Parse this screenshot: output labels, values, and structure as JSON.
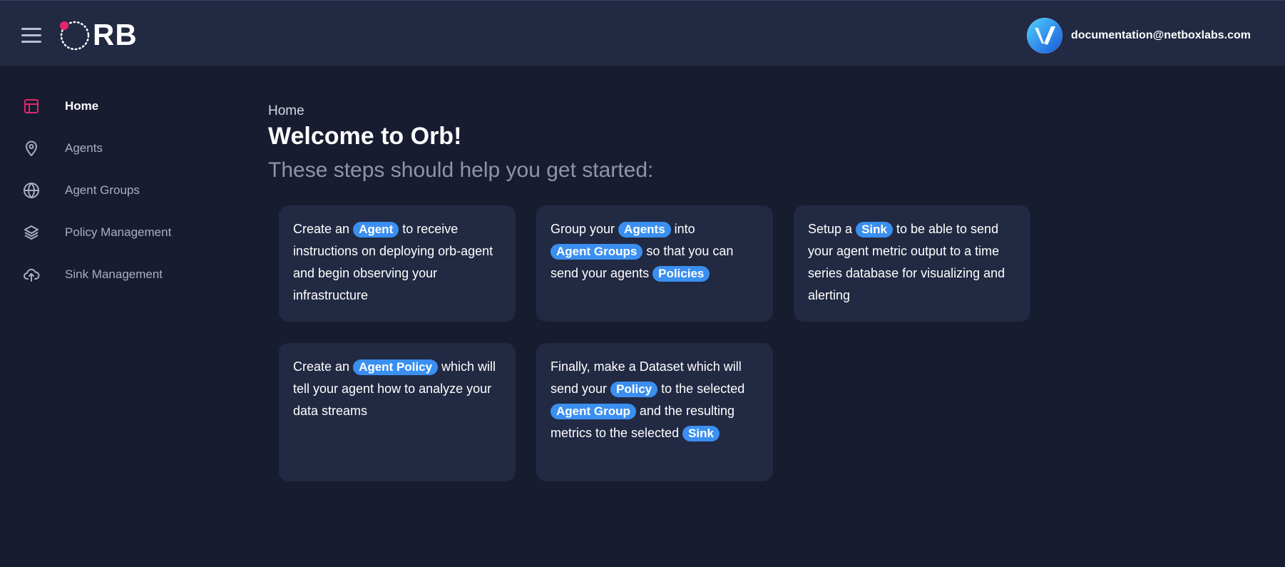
{
  "header": {
    "logo_text": "RB",
    "user_email": "documentation@netboxlabs.com"
  },
  "colors": {
    "accent": "#e4256a",
    "chip": "#3a8ff0",
    "background": "#171c30",
    "panel": "#222942"
  },
  "sidebar": {
    "items": [
      {
        "label": "Home",
        "icon": "layout-icon",
        "active": true
      },
      {
        "label": "Agents",
        "icon": "map-pin-icon",
        "active": false
      },
      {
        "label": "Agent Groups",
        "icon": "globe-icon",
        "active": false
      },
      {
        "label": "Policy Management",
        "icon": "layers-icon",
        "active": false
      },
      {
        "label": "Sink Management",
        "icon": "cloud-upload-icon",
        "active": false
      }
    ]
  },
  "main": {
    "breadcrumb": "Home",
    "title": "Welcome to Orb!",
    "subtitle": "These steps should help you get started:",
    "cards": [
      {
        "t1": "Create an ",
        "c1": "Agent",
        "t2": " to receive instructions on deploying orb-agent and begin observing your infrastructure"
      },
      {
        "t1": "Group your ",
        "c1": "Agents",
        "t2": " into ",
        "c2": "Agent Groups",
        "t3": " so that you can send your agents ",
        "c3": "Policies"
      },
      {
        "t1": "Setup a ",
        "c1": "Sink",
        "t2": " to be able to send your agent metric output to a time series database for visualizing and alerting"
      },
      {
        "t1": "Create an ",
        "c1": "Agent Policy",
        "t2": " which will tell your agent how to analyze your data streams"
      },
      {
        "t1": "Finally, make a Dataset which will send your ",
        "c1": "Policy",
        "t2": " to the selected ",
        "c2": "Agent Group",
        "t3": " and the resulting metrics to the selected ",
        "c3": "Sink"
      }
    ]
  }
}
